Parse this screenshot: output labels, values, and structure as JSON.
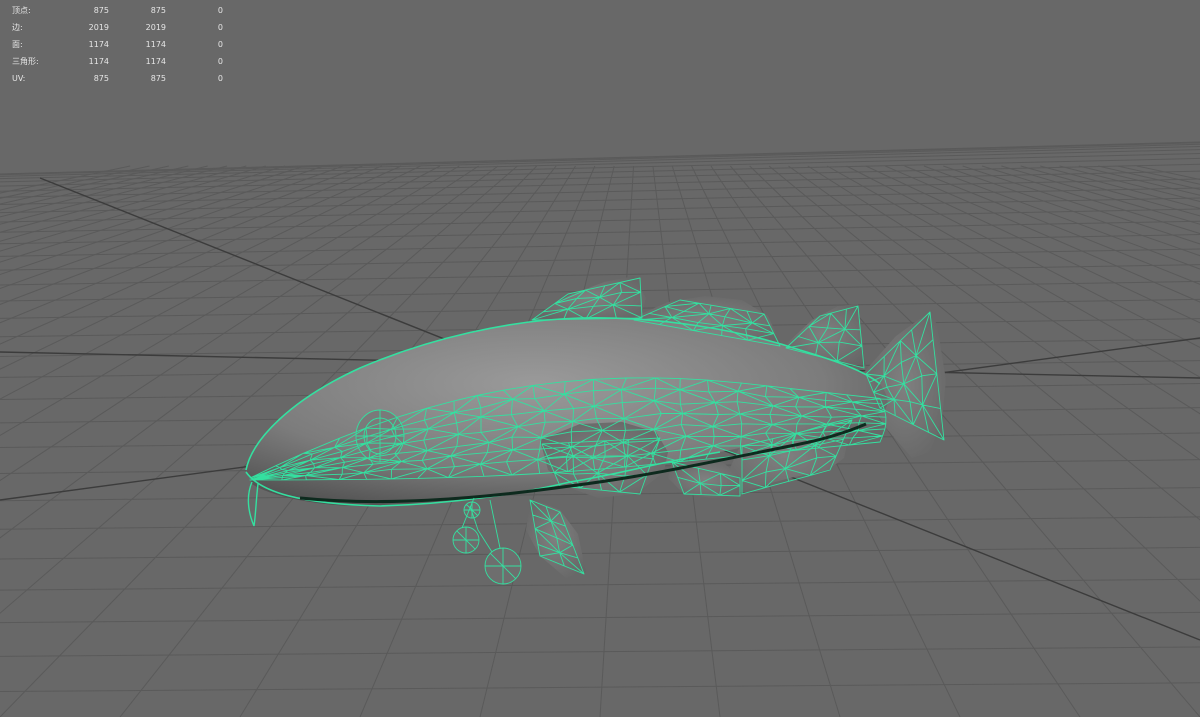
{
  "viewport": {
    "background": "#686868",
    "grid_color": "#5a5a5a",
    "grid_axis_color": "#3c3c3c",
    "wire_color": "#34e0a0",
    "mesh_fill": "#8e8e8e"
  },
  "heads_up_display": {
    "rows": [
      {
        "label": "顶点:",
        "values": [
          "875",
          "875",
          "0"
        ]
      },
      {
        "label": "边:",
        "values": [
          "2019",
          "2019",
          "0"
        ]
      },
      {
        "label": "面:",
        "values": [
          "1174",
          "1174",
          "0"
        ]
      },
      {
        "label": "三角形:",
        "values": [
          "1174",
          "1174",
          "0"
        ]
      },
      {
        "label": "UV:",
        "values": [
          "875",
          "875",
          "0"
        ]
      }
    ]
  },
  "model": {
    "name": "fish-wireframe-mesh",
    "display_mode": "wireframe-on-shaded",
    "selected": true
  }
}
